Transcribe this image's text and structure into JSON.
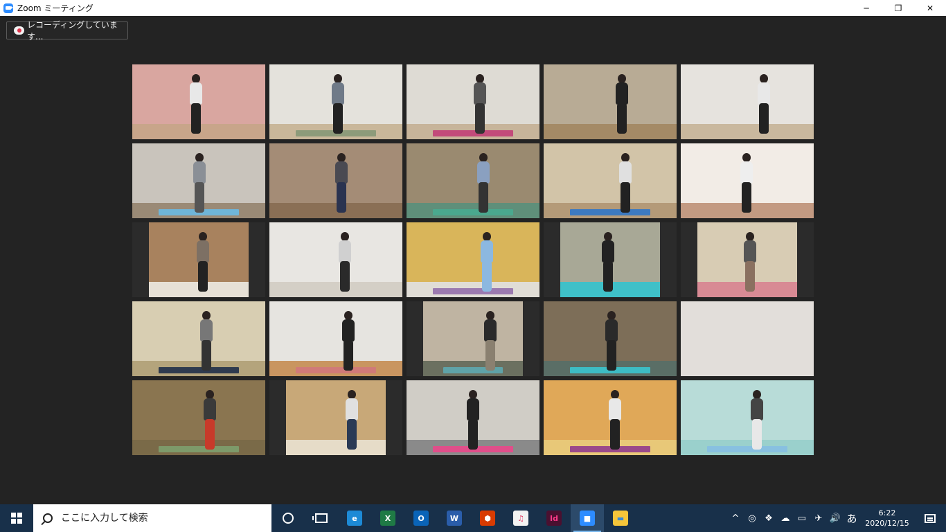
{
  "window": {
    "title": "Zoom ミーティング",
    "minimize_glyph": "─",
    "restore_glyph": "❐",
    "close_glyph": "✕"
  },
  "meeting": {
    "recording_label": "レコーディングしています...",
    "tiles": [
      {
        "bg": "#d9a6a0",
        "video": "full",
        "floor": "#c8a58a",
        "mat": "",
        "top": "#e8e8e8",
        "legs": "#222"
      },
      {
        "bg": "#e4e2dc",
        "video": "full",
        "floor": "#c9b79a",
        "mat": "#8d9b7a",
        "top": "#6f7a88",
        "legs": "#222"
      },
      {
        "bg": "#dedbd4",
        "video": "full",
        "floor": "#c7b49a",
        "mat": "#c24b7a",
        "top": "#555",
        "legs": "#333"
      },
      {
        "bg": "#b8ab95",
        "video": "full",
        "floor": "#a48a66",
        "mat": "",
        "top": "#222",
        "legs": "#222"
      },
      {
        "bg": "#e6e3de",
        "video": "full",
        "floor": "#c9b89e",
        "mat": "",
        "top": "#e8e8e8",
        "legs": "#222"
      },
      {
        "bg": "#c9c4bc",
        "video": "full",
        "floor": "#9a8a76",
        "mat": "#6fb5d8",
        "top": "#8a8f96",
        "legs": "#555"
      },
      {
        "bg": "#a48c76",
        "video": "full",
        "floor": "#8a6f55",
        "mat": "",
        "top": "#4a4a52",
        "legs": "#2a3350"
      },
      {
        "bg": "#9a8a70",
        "video": "full",
        "floor": "#5f8f7a",
        "mat": "#4aa88e",
        "top": "#8aa0c0",
        "legs": "#333"
      },
      {
        "bg": "#d2c4a8",
        "video": "full",
        "floor": "#b49a78",
        "mat": "#3d7ac0",
        "top": "#e0e0e0",
        "legs": "#222"
      },
      {
        "bg": "#f2ece6",
        "video": "full",
        "floor": "#c39a82",
        "mat": "",
        "top": "#eeeeee",
        "legs": "#222"
      },
      {
        "bg": "#a8825e",
        "video": "narrow",
        "floor": "#e6e0d6",
        "mat": "",
        "top": "#7d7064",
        "legs": "#222"
      },
      {
        "bg": "#e8e6e2",
        "video": "full",
        "floor": "#d4cfc6",
        "mat": "",
        "top": "#d0d0d0",
        "legs": "#2a2a2a"
      },
      {
        "bg": "#d9b55a",
        "video": "full",
        "floor": "#e0ddd6",
        "mat": "#9b7ab0",
        "top": "#8cb8e0",
        "legs": "#8cb8e0"
      },
      {
        "bg": "#a8a896",
        "video": "narrow",
        "floor": "#3fc0c8",
        "mat": "",
        "top": "#222",
        "legs": "#222"
      },
      {
        "bg": "#d8ccb4",
        "video": "narrow",
        "floor": "#d88a94",
        "mat": "",
        "top": "#555",
        "legs": "#8a7060"
      },
      {
        "bg": "#d8ceb2",
        "video": "full",
        "floor": "#b4a47c",
        "mat": "#2e3a4e",
        "top": "#777",
        "legs": "#333"
      },
      {
        "bg": "#e6e4e0",
        "video": "full",
        "floor": "#c99560",
        "mat": "#d07a78",
        "top": "#222",
        "legs": "#222"
      },
      {
        "bg": "#bfb4a2",
        "video": "narrow",
        "floor": "#6b7060",
        "mat": "#5fa3a8",
        "top": "#2a2a2a",
        "legs": "#8a8070"
      },
      {
        "bg": "#7d6e58",
        "video": "full",
        "floor": "#5a6e66",
        "mat": "#3dbcc4",
        "top": "#2a2a2a",
        "legs": "#222"
      },
      {
        "bg": "#e2deda",
        "video": "full",
        "floor": "#e2deda",
        "mat": "",
        "top": "",
        "legs": ""
      },
      {
        "bg": "#8a7550",
        "video": "full",
        "floor": "#7a6a48",
        "mat": "#7d9a6a",
        "top": "#3a3a3a",
        "legs": "#c83a2a"
      },
      {
        "bg": "#c8a878",
        "video": "narrow",
        "floor": "#e6dcc8",
        "mat": "",
        "top": "#e0e0e0",
        "legs": "#2a3a55"
      },
      {
        "bg": "#d0cdc6",
        "video": "full",
        "floor": "#8a8a8a",
        "mat": "#e04e8a",
        "top": "#222",
        "legs": "#222"
      },
      {
        "bg": "#e0a858",
        "video": "full",
        "floor": "#e8c878",
        "mat": "#9a4a8a",
        "top": "#e8e8e8",
        "legs": "#222"
      },
      {
        "bg": "#b8dcd8",
        "video": "full",
        "floor": "#9ad0cc",
        "mat": "#88c0e0",
        "top": "#444",
        "legs": "#e8e8e8"
      }
    ]
  },
  "taskbar": {
    "search_placeholder": "ここに入力して検索",
    "apps": [
      {
        "name": "cortana",
        "kind": "cortana"
      },
      {
        "name": "task-view",
        "kind": "taskview"
      },
      {
        "name": "edge",
        "kind": "app",
        "color": "#1d8ad6",
        "glyph": "e"
      },
      {
        "name": "excel",
        "kind": "app",
        "color": "#1f7a45",
        "glyph": "X"
      },
      {
        "name": "outlook",
        "kind": "app",
        "color": "#0a64b8",
        "glyph": "O"
      },
      {
        "name": "word",
        "kind": "app",
        "color": "#2a5daa",
        "glyph": "W"
      },
      {
        "name": "office",
        "kind": "app",
        "color": "#d83b01",
        "glyph": "⬢"
      },
      {
        "name": "itunes",
        "kind": "app",
        "color": "#f2f2f2",
        "glyph": "♫",
        "fg": "#e2446a"
      },
      {
        "name": "indesign",
        "kind": "app",
        "color": "#4a1030",
        "glyph": "Id",
        "fg": "#ff3a8a"
      },
      {
        "name": "zoom",
        "kind": "app",
        "color": "#2d8cff",
        "glyph": "■",
        "active": true
      },
      {
        "name": "file-explorer",
        "kind": "app",
        "color": "#f5c53a",
        "glyph": "▬",
        "fg": "#3a8ad6"
      }
    ],
    "tray": {
      "chevron": "^",
      "ime": "あ",
      "volume": "🔊",
      "time": "6:22",
      "date": "2020/12/15"
    }
  }
}
